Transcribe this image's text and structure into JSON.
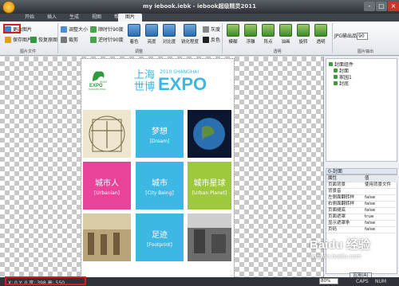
{
  "window": {
    "title": "my iebook.iebk - iebook超级精灵2011",
    "controls": [
      "-",
      "▢",
      "×"
    ]
  },
  "menu": {
    "items": [
      "开始",
      "插入",
      "生成",
      "视图",
      "帮助",
      "图片"
    ],
    "active": "图片"
  },
  "ribbon": {
    "group_file": {
      "label": "图片文件",
      "buttons": [
        "更改图片",
        "保存图片",
        "恢复原图"
      ]
    },
    "group_adjust": {
      "label": "调整",
      "small_buttons": [
        "调整大小",
        "顺时针90度",
        "逆时针90度",
        "裁剪"
      ],
      "big_buttons": [
        "着色",
        "亮度",
        "对比度",
        "锐化程度",
        "灰度",
        "反色"
      ]
    },
    "group_effects": {
      "label": "透明",
      "big_buttons": [
        "模糊",
        "浮雕",
        "阵点",
        "油画",
        "旋转",
        "透明"
      ]
    },
    "group_export": {
      "label": "图片输出",
      "quality_label": "JPG输出品质",
      "quality_value": "90"
    }
  },
  "book": {
    "expo_cn_line1": "上海",
    "expo_cn_line2": "世博",
    "expo_year": "2010 SHANGHAI",
    "expo_big": "EXPO",
    "logo_text": "EXPO",
    "logo_year": "2010",
    "logo_sub": "SHANGHAI CHINA",
    "tiles": [
      {
        "cn": "梦想",
        "en": "[Dream]",
        "color": "#3db7e4"
      },
      {
        "cn": "城市人",
        "en": "[Urbanian]",
        "color": "#e9449a"
      },
      {
        "cn": "城市",
        "en": "[City Being]",
        "color": "#3db7e4"
      },
      {
        "cn": "城市星球",
        "en": "[Urban Planet]",
        "color": "#9fc93c"
      },
      {
        "cn": "足迹",
        "en": "[Footprint]",
        "color": "#3db7e4"
      }
    ]
  },
  "tree": {
    "items": [
      "封面组件",
      "封面",
      "家园1",
      "封底"
    ]
  },
  "properties": {
    "title": "0-封面",
    "header_key": "属性",
    "header_value": "值",
    "rows": [
      {
        "key": "页面背景",
        "value": "使用背景文件"
      },
      {
        "key": "背景音",
        "value": ""
      },
      {
        "key": "左侧面翻转样",
        "value": "false"
      },
      {
        "key": "右侧面翻转样",
        "value": "false"
      },
      {
        "key": "页面褪底",
        "value": "false"
      },
      {
        "key": "页面遮罩",
        "value": "true"
      },
      {
        "key": "显示遮罩条",
        "value": "false"
      },
      {
        "key": "页码",
        "value": "false"
      }
    ],
    "apply_label": "应用(A)"
  },
  "status": {
    "coords": "X: 0  Y: 0  宽: 398  高: 550",
    "zoom": "80%",
    "caps": "CAPS",
    "num": "NUM"
  },
  "watermark": {
    "brand": "Baidu 经验",
    "url": "jingyan.baidu.com"
  },
  "colors": {
    "accent_blue": "#3db7e4",
    "accent_pink": "#e9449a",
    "accent_green": "#9fc93c",
    "highlight_red": "#d21d1d"
  }
}
